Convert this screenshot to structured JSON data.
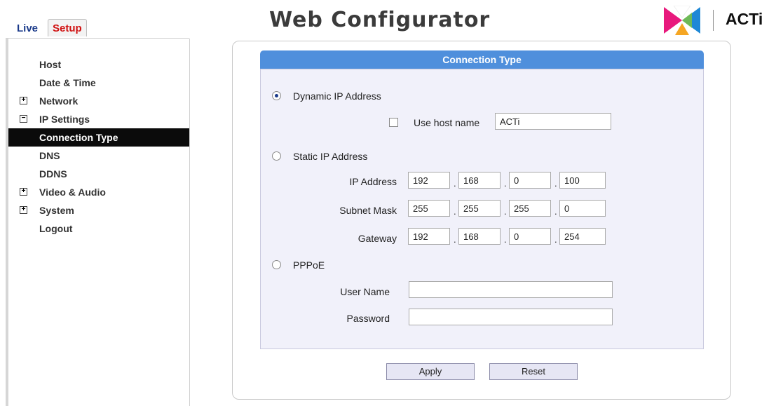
{
  "header": {
    "tabs": [
      {
        "label": "Live"
      },
      {
        "label": "Setup"
      }
    ],
    "title": "Web Configurator",
    "brand": "ACTi"
  },
  "sidebar": {
    "items": [
      {
        "label": "Host",
        "expander": ""
      },
      {
        "label": "Date & Time",
        "expander": ""
      },
      {
        "label": "Network",
        "expander": "+"
      },
      {
        "label": "IP Settings",
        "expander": "−"
      },
      {
        "label": "Connection Type",
        "expander": "",
        "active": true
      },
      {
        "label": "DNS",
        "expander": ""
      },
      {
        "label": "DDNS",
        "expander": ""
      },
      {
        "label": "Video & Audio",
        "expander": "+"
      },
      {
        "label": "System",
        "expander": "+"
      },
      {
        "label": "Logout",
        "expander": ""
      }
    ]
  },
  "form": {
    "section_title": "Connection Type",
    "dynamic": {
      "label": "Dynamic IP Address",
      "selected": true
    },
    "use_host_name": {
      "label": "Use host name",
      "checked": false,
      "value": "ACTi"
    },
    "static": {
      "label": "Static IP Address",
      "selected": false
    },
    "ip_address": {
      "label": "IP Address",
      "octets": [
        "192",
        "168",
        "0",
        "100"
      ]
    },
    "subnet_mask": {
      "label": "Subnet Mask",
      "octets": [
        "255",
        "255",
        "255",
        "0"
      ]
    },
    "gateway": {
      "label": "Gateway",
      "octets": [
        "192",
        "168",
        "0",
        "254"
      ]
    },
    "octet_separator": ".",
    "pppoe": {
      "label": "PPPoE",
      "selected": false
    },
    "user_name": {
      "label": "User Name",
      "value": ""
    },
    "password": {
      "label": "Password",
      "value": ""
    },
    "apply_label": "Apply",
    "reset_label": "Reset"
  },
  "colors": {
    "section_header": "#4f8fdc",
    "panel_bg": "#f1f1fa",
    "active_item_bg": "#0b0b0b",
    "setup_tab_text": "#d01010",
    "live_tab_text": "#1a3a8a"
  }
}
